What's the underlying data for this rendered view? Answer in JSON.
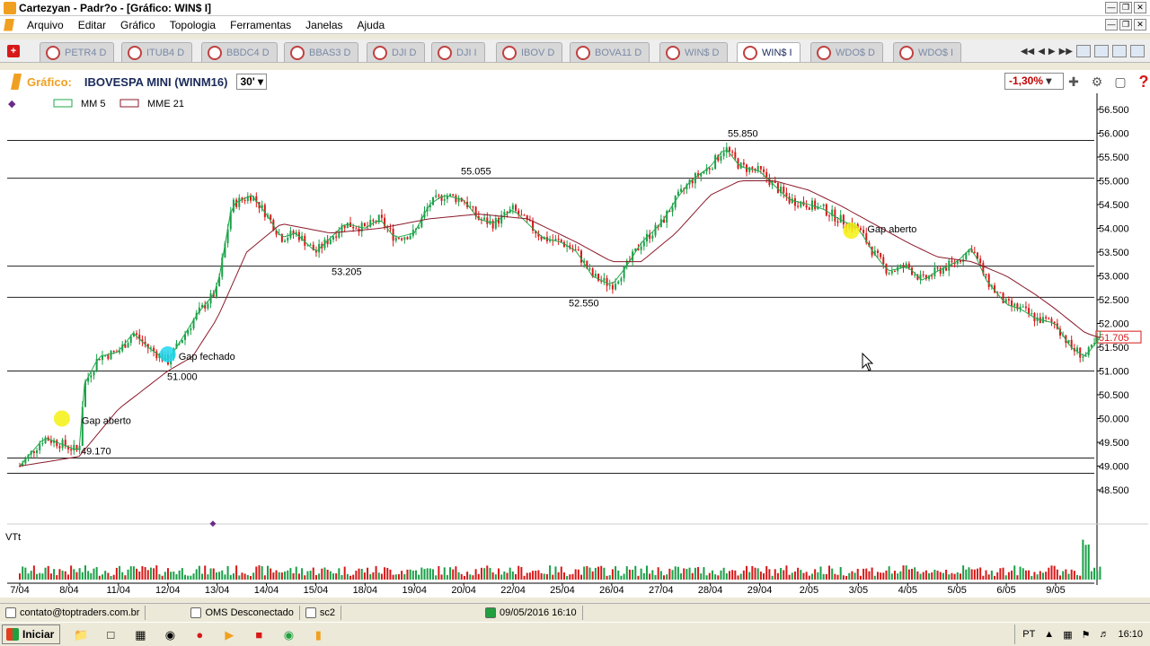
{
  "window": {
    "title": "Cartezyan - Padr?o - [Gráfico: WIN$ I]"
  },
  "menu": [
    "Arquivo",
    "Editar",
    "Gráfico",
    "Topologia",
    "Ferramentas",
    "Janelas",
    "Ajuda"
  ],
  "tabs": [
    "PETR4 D",
    "ITUB4 D",
    "BBDC4 D",
    "BBAS3 D",
    "DJI D",
    "DJI I",
    "IBOV D",
    "BOVA11 D",
    "WIN$ D",
    "WIN$ I",
    "WDO$ D",
    "WDO$ I"
  ],
  "active_tab": "WIN$ I",
  "chart_header": {
    "label": "Gráfico:",
    "symbol": "IBOVESPA MINI (WINM16)",
    "period": "30'",
    "change": "-1,30%"
  },
  "legend": {
    "mm": "MM  5",
    "mme": "MME 21"
  },
  "volume_label": "VTt",
  "colors": {
    "up": "#1aa048",
    "down": "#d81818",
    "mm_line": "#20a848",
    "mme_line": "#8a1a2a",
    "accent": "#f0a020"
  },
  "chart_data": {
    "type": "candlestick",
    "y_axis": {
      "ticks": [
        "56.500",
        "56.000",
        "55.500",
        "55.000",
        "54.500",
        "54.000",
        "53.500",
        "53.000",
        "52.500",
        "52.000",
        "51.500",
        "51.000",
        "50.500",
        "50.000",
        "49.500",
        "49.000",
        "48.500"
      ],
      "range": [
        48500,
        56500
      ],
      "current": "51.705"
    },
    "x_axis": {
      "ticks": [
        "7/04",
        "8/04",
        "11/04",
        "12/04",
        "13/04",
        "14/04",
        "15/04",
        "18/04",
        "19/04",
        "20/04",
        "22/04",
        "25/04",
        "26/04",
        "27/04",
        "28/04",
        "29/04",
        "2/05",
        "3/05",
        "4/05",
        "5/05",
        "6/05",
        "9/05"
      ]
    },
    "levels": [
      {
        "value": 55850,
        "label": "55.850"
      },
      {
        "value": 55055,
        "label": "55.055"
      },
      {
        "value": 53205,
        "label": "53.205"
      },
      {
        "value": 52550,
        "label": "52.550"
      },
      {
        "value": 51000,
        "label": "51.000"
      },
      {
        "value": 49170,
        "label": "49.170"
      },
      {
        "value": 48850,
        "label": ""
      }
    ],
    "annotations": [
      {
        "text": "Gap aberto",
        "x_index": 1,
        "value": 50000,
        "color": "#f4f010"
      },
      {
        "text": "Gap fechado",
        "x_index": 3,
        "value": 51350,
        "color": "#20d8f0"
      },
      {
        "text": "Gap aberto",
        "x_index": 17,
        "value": 53950,
        "color": "#f4f010"
      }
    ],
    "close_path": [
      [
        0,
        49000
      ],
      [
        0.5,
        49600
      ],
      [
        1,
        49400
      ],
      [
        1.2,
        49300
      ],
      [
        1.3,
        50700
      ],
      [
        1.6,
        51300
      ],
      [
        2,
        51400
      ],
      [
        2.3,
        51800
      ],
      [
        2.6,
        51500
      ],
      [
        3,
        51200
      ],
      [
        3.3,
        51700
      ],
      [
        3.6,
        52200
      ],
      [
        4,
        52700
      ],
      [
        4.3,
        54500
      ],
      [
        4.7,
        54700
      ],
      [
        5,
        54300
      ],
      [
        5.3,
        53800
      ],
      [
        5.6,
        53900
      ],
      [
        6,
        53500
      ],
      [
        6.3,
        53800
      ],
      [
        6.6,
        54100
      ],
      [
        7,
        54000
      ],
      [
        7.3,
        54200
      ],
      [
        7.6,
        53800
      ],
      [
        8,
        53900
      ],
      [
        8.3,
        54500
      ],
      [
        8.6,
        54700
      ],
      [
        9,
        54600
      ],
      [
        9.3,
        54200
      ],
      [
        9.6,
        54100
      ],
      [
        10,
        54400
      ],
      [
        10.3,
        54100
      ],
      [
        10.6,
        53800
      ],
      [
        11,
        53700
      ],
      [
        11.3,
        53500
      ],
      [
        11.6,
        53000
      ],
      [
        12,
        52800
      ],
      [
        12.3,
        53200
      ],
      [
        12.6,
        53700
      ],
      [
        13,
        54100
      ],
      [
        13.3,
        54600
      ],
      [
        13.6,
        55000
      ],
      [
        14,
        55300
      ],
      [
        14.3,
        55700
      ],
      [
        14.6,
        55300
      ],
      [
        15,
        55200
      ],
      [
        15.3,
        54900
      ],
      [
        15.6,
        54600
      ],
      [
        16,
        54500
      ],
      [
        16.3,
        54400
      ],
      [
        16.6,
        54200
      ],
      [
        17,
        54000
      ],
      [
        17.3,
        53500
      ],
      [
        17.6,
        53100
      ],
      [
        18,
        53200
      ],
      [
        18.3,
        52900
      ],
      [
        18.6,
        53100
      ],
      [
        19,
        53300
      ],
      [
        19.3,
        53600
      ],
      [
        19.6,
        52900
      ],
      [
        20,
        52400
      ],
      [
        20.3,
        52300
      ],
      [
        20.6,
        52100
      ],
      [
        21,
        52000
      ],
      [
        21.3,
        51500
      ],
      [
        21.6,
        51300
      ],
      [
        21.9,
        51705
      ]
    ],
    "mma_path": [
      [
        0,
        49000
      ],
      [
        1.2,
        49200
      ],
      [
        2,
        50200
      ],
      [
        3,
        51000
      ],
      [
        3.5,
        51300
      ],
      [
        4,
        52100
      ],
      [
        4.6,
        53500
      ],
      [
        5.3,
        54100
      ],
      [
        6.3,
        53900
      ],
      [
        7.3,
        54000
      ],
      [
        8.3,
        54200
      ],
      [
        9.3,
        54300
      ],
      [
        10.3,
        54200
      ],
      [
        11.3,
        53700
      ],
      [
        12,
        53300
      ],
      [
        12.6,
        53300
      ],
      [
        13.3,
        53900
      ],
      [
        14,
        54700
      ],
      [
        14.6,
        55000
      ],
      [
        15.3,
        55000
      ],
      [
        16,
        54800
      ],
      [
        16.6,
        54500
      ],
      [
        17.3,
        54100
      ],
      [
        18,
        53700
      ],
      [
        18.6,
        53400
      ],
      [
        19.3,
        53300
      ],
      [
        20,
        53000
      ],
      [
        20.6,
        52600
      ],
      [
        21,
        52300
      ],
      [
        21.6,
        51800
      ],
      [
        21.9,
        51700
      ]
    ]
  },
  "statusbar": {
    "contact": "contato@toptraders.com.br",
    "oms": "OMS Desconectado",
    "server": "sc2",
    "datetime": "09/05/2016 16:10"
  },
  "taskbar": {
    "start": "Iniciar",
    "lang": "PT",
    "clock": "16:10"
  }
}
